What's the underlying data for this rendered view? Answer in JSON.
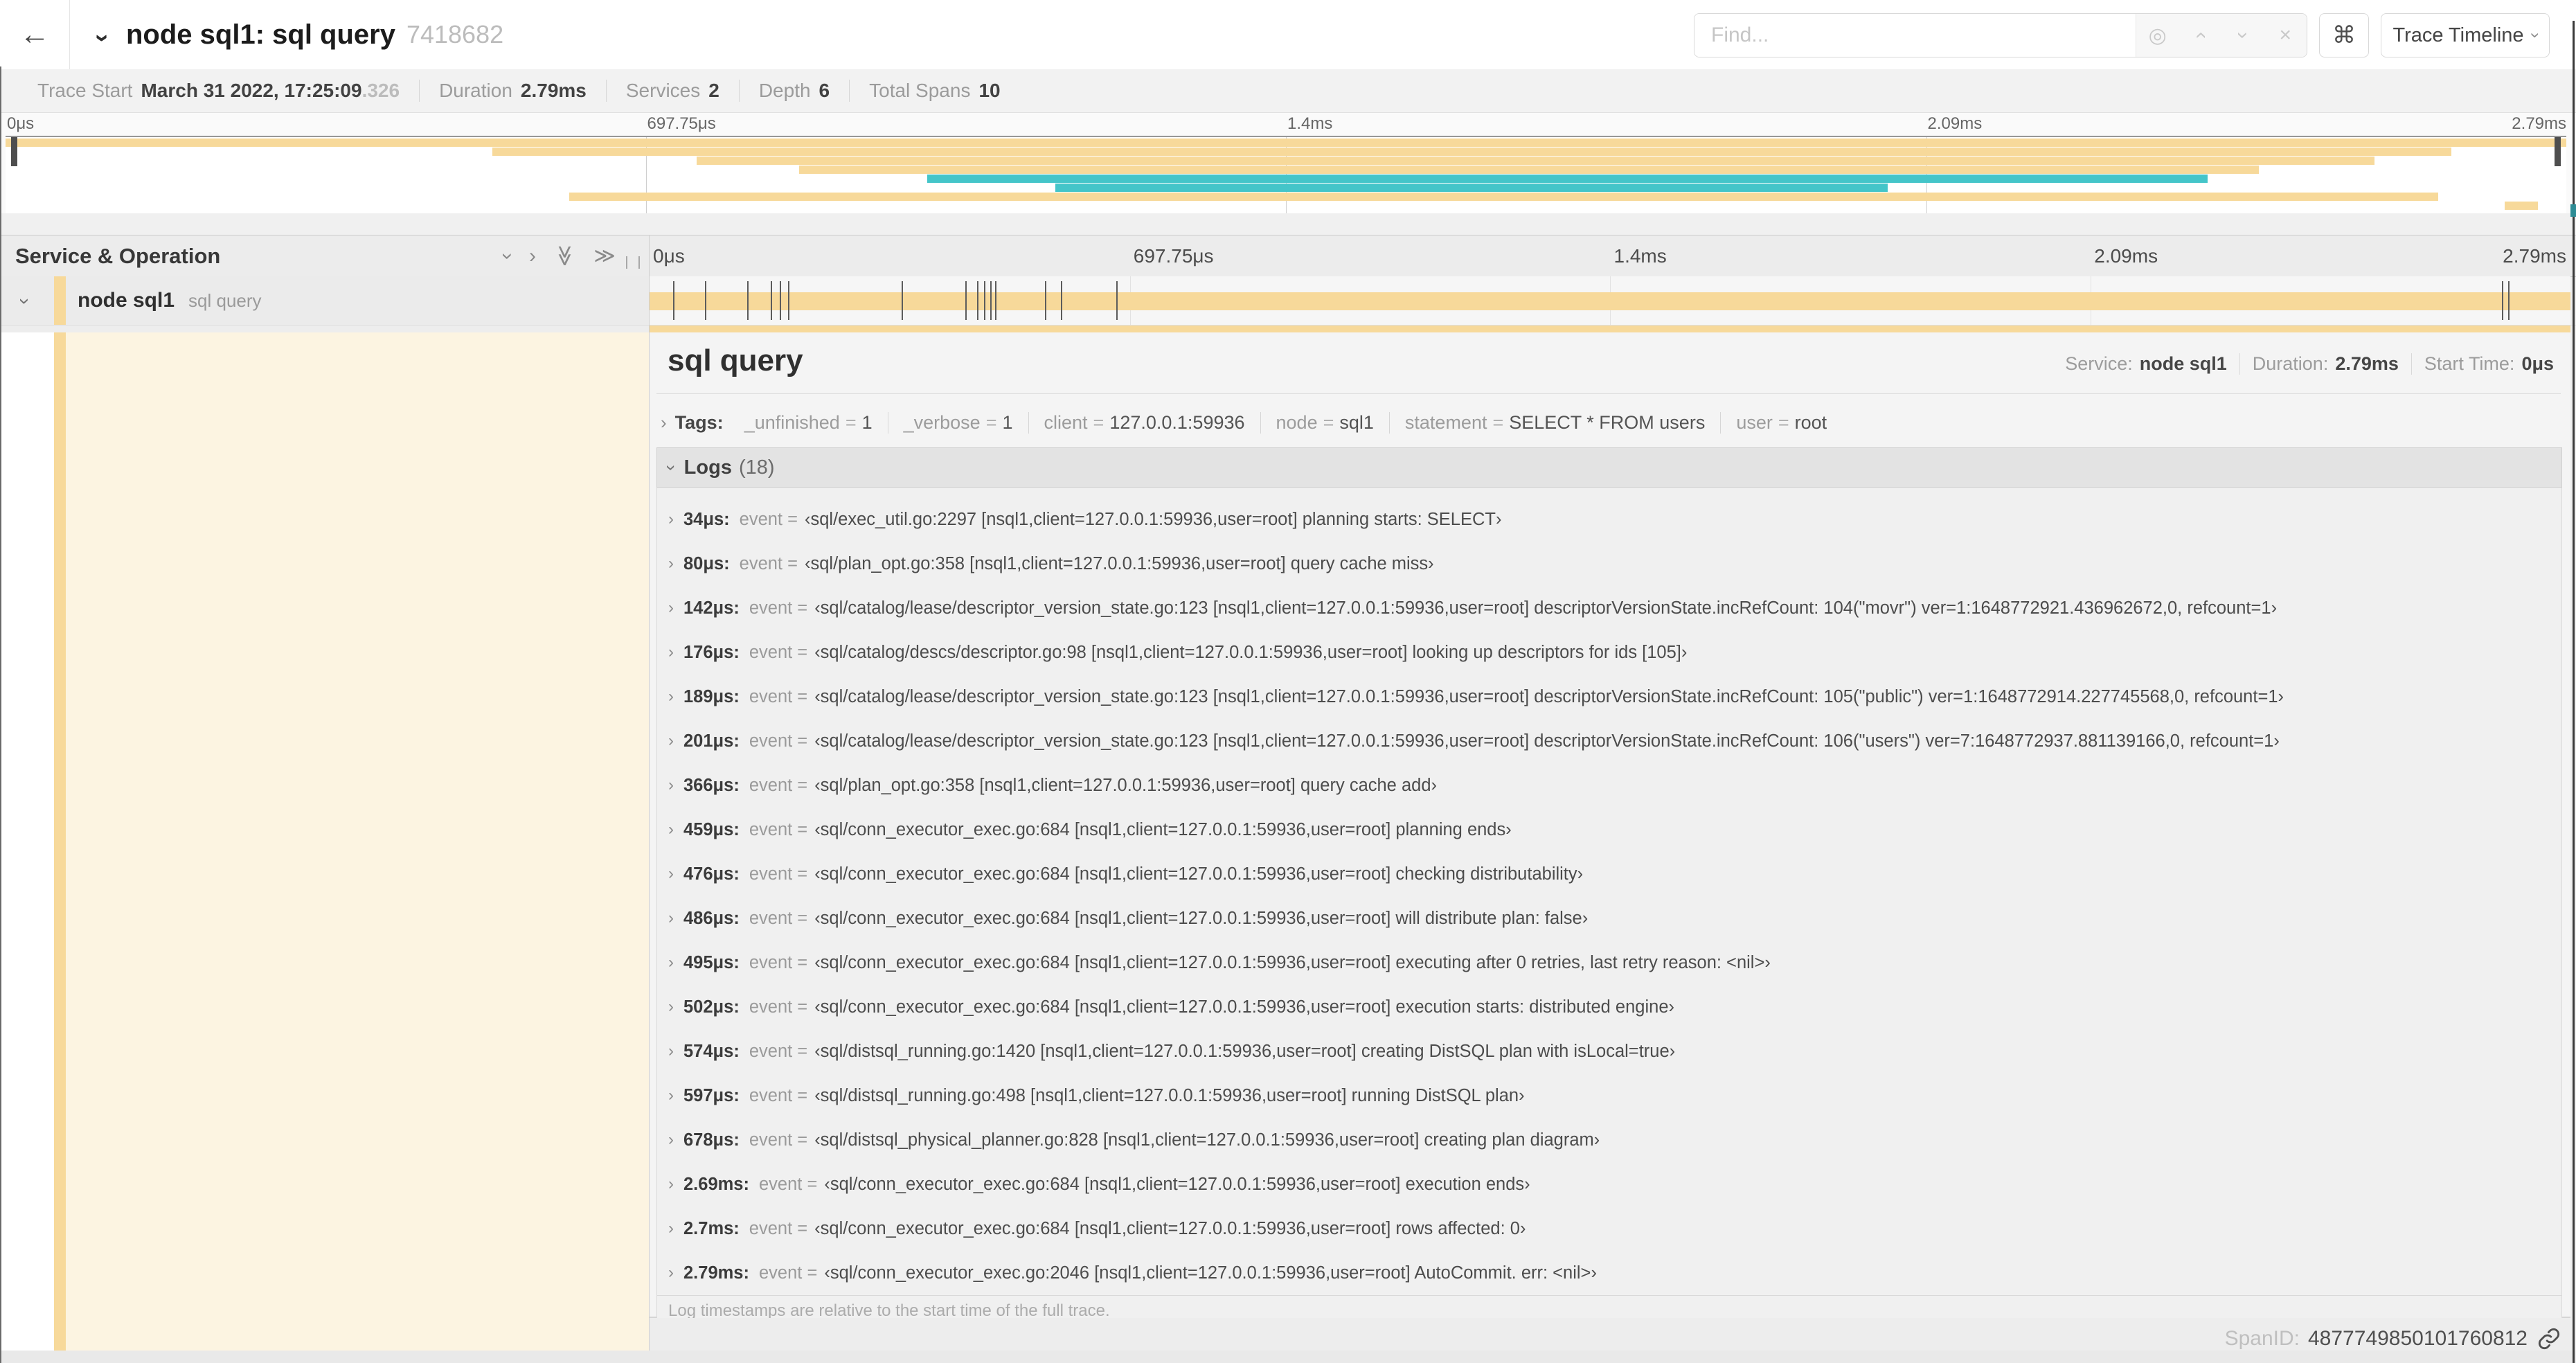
{
  "icons": {
    "back": "←",
    "chevron": "›",
    "double_chevron": "≫",
    "target": "◎",
    "close": "×",
    "cmd": "⌘",
    "grip": "",
    "link": "link"
  },
  "colors": {
    "span_tan": "#F7D99A",
    "span_teal": "#44C5C9",
    "cream": "#FCF4E1"
  },
  "header": {
    "title": "node sql1: sql query",
    "trace_id": "7418682",
    "find_placeholder": "Find...",
    "view_button": "Trace Timeline"
  },
  "meta": {
    "items": [
      {
        "label": "Trace Start",
        "value": "March 31 2022, 17:25:09",
        "extra": ".326"
      },
      {
        "label": "Duration",
        "value": "2.79ms",
        "extra": ""
      },
      {
        "label": "Services",
        "value": "2",
        "extra": ""
      },
      {
        "label": "Depth",
        "value": "6",
        "extra": ""
      },
      {
        "label": "Total Spans",
        "value": "10",
        "extra": ""
      }
    ]
  },
  "minimap": {
    "ticks": [
      {
        "label": "0μs",
        "l": "2px"
      },
      {
        "label": "697.75μs",
        "l": "calc(25% + 2px)"
      },
      {
        "label": "1.4ms",
        "l": "calc(50% + 2px)"
      },
      {
        "label": "2.09ms",
        "l": "calc(75% + 2px)"
      },
      {
        "label": "2.79ms",
        "l": "100%"
      }
    ],
    "spans": [
      {
        "c": "#F7D99A",
        "l": "0%",
        "w": "100%",
        "t": "2px"
      },
      {
        "c": "#F7D99A",
        "l": "19%",
        "w": "76.5%",
        "t": "15px"
      },
      {
        "c": "#F7D99A",
        "l": "27%",
        "w": "65.5%",
        "t": "28px"
      },
      {
        "c": "#F7D99A",
        "l": "31%",
        "w": "57%",
        "t": "41px"
      },
      {
        "c": "#44C5C9",
        "l": "36%",
        "w": "50%",
        "t": "54px"
      },
      {
        "c": "#44C5C9",
        "l": "41%",
        "w": "32.5%",
        "t": "67px"
      },
      {
        "c": "#F7D99A",
        "l": "22%",
        "w": "73%",
        "t": "80px"
      },
      {
        "c": "#F7D99A",
        "l": "97.6%",
        "w": "1.3%",
        "t": "93px"
      }
    ]
  },
  "timeline": {
    "column_title": "Service & Operation",
    "ticks": [
      {
        "label": "0μs",
        "l": "6px"
      },
      {
        "label": "697.75μs",
        "l": "calc(25% + 6px)"
      },
      {
        "label": "1.4ms",
        "l": "calc(50% + 6px)"
      },
      {
        "label": "2.09ms",
        "l": "calc(75% + 6px)"
      },
      {
        "label": "2.79ms",
        "l": "100%"
      }
    ]
  },
  "span_row": {
    "service": "node sql1",
    "operation": "sql query",
    "events": [
      {
        "l": "1.22%"
      },
      {
        "l": "2.87%"
      },
      {
        "l": "5.09%"
      },
      {
        "l": "6.31%"
      },
      {
        "l": "6.77%"
      },
      {
        "l": "7.2%"
      },
      {
        "l": "13.12%"
      },
      {
        "l": "16.45%"
      },
      {
        "l": "17.06%"
      },
      {
        "l": "17.42%"
      },
      {
        "l": "17.74%"
      },
      {
        "l": "18.0%"
      },
      {
        "l": "20.57%"
      },
      {
        "l": "21.4%"
      },
      {
        "l": "24.3%"
      },
      {
        "l": "96.42%"
      },
      {
        "l": "96.77%"
      }
    ]
  },
  "detail": {
    "title": "sql query",
    "overview": [
      {
        "label": "Service:",
        "value": "node sql1"
      },
      {
        "label": "Duration:",
        "value": "2.79ms"
      },
      {
        "label": "Start Time:",
        "value": "0μs"
      }
    ],
    "tags_label": "Tags:",
    "tags": [
      {
        "k": "_unfinished",
        "eq": "=",
        "v": "1"
      },
      {
        "k": "_verbose",
        "eq": "=",
        "v": "1"
      },
      {
        "k": "client",
        "eq": "=",
        "v": "127.0.0.1:59936"
      },
      {
        "k": "node",
        "eq": "=",
        "v": "sql1"
      },
      {
        "k": "statement",
        "eq": "=",
        "v": "SELECT * FROM users"
      },
      {
        "k": "user",
        "eq": "=",
        "v": "root"
      }
    ],
    "logs_label": "Logs",
    "logs_count": "(18)",
    "logs": [
      {
        "t": "34μs:",
        "k": "event =",
        "v": "‹sql/exec_util.go:2297 [nsql1,client=127.0.0.1:59936,user=root] planning starts: SELECT›"
      },
      {
        "t": "80μs:",
        "k": "event =",
        "v": "‹sql/plan_opt.go:358 [nsql1,client=127.0.0.1:59936,user=root] query cache miss›"
      },
      {
        "t": "142μs:",
        "k": "event =",
        "v": "‹sql/catalog/lease/descriptor_version_state.go:123 [nsql1,client=127.0.0.1:59936,user=root] descriptorVersionState.incRefCount: 104(\"movr\") ver=1:1648772921.436962672,0, refcount=1›"
      },
      {
        "t": "176μs:",
        "k": "event =",
        "v": "‹sql/catalog/descs/descriptor.go:98 [nsql1,client=127.0.0.1:59936,user=root] looking up descriptors for ids [105]›"
      },
      {
        "t": "189μs:",
        "k": "event =",
        "v": "‹sql/catalog/lease/descriptor_version_state.go:123 [nsql1,client=127.0.0.1:59936,user=root] descriptorVersionState.incRefCount: 105(\"public\") ver=1:1648772914.227745568,0, refcount=1›"
      },
      {
        "t": "201μs:",
        "k": "event =",
        "v": "‹sql/catalog/lease/descriptor_version_state.go:123 [nsql1,client=127.0.0.1:59936,user=root] descriptorVersionState.incRefCount: 106(\"users\") ver=7:1648772937.881139166,0, refcount=1›"
      },
      {
        "t": "366μs:",
        "k": "event =",
        "v": "‹sql/plan_opt.go:358 [nsql1,client=127.0.0.1:59936,user=root] query cache add›"
      },
      {
        "t": "459μs:",
        "k": "event =",
        "v": "‹sql/conn_executor_exec.go:684 [nsql1,client=127.0.0.1:59936,user=root] planning ends›"
      },
      {
        "t": "476μs:",
        "k": "event =",
        "v": "‹sql/conn_executor_exec.go:684 [nsql1,client=127.0.0.1:59936,user=root] checking distributability›"
      },
      {
        "t": "486μs:",
        "k": "event =",
        "v": "‹sql/conn_executor_exec.go:684 [nsql1,client=127.0.0.1:59936,user=root] will distribute plan: false›"
      },
      {
        "t": "495μs:",
        "k": "event =",
        "v": "‹sql/conn_executor_exec.go:684 [nsql1,client=127.0.0.1:59936,user=root] executing after 0 retries, last retry reason: <nil>›"
      },
      {
        "t": "502μs:",
        "k": "event =",
        "v": "‹sql/conn_executor_exec.go:684 [nsql1,client=127.0.0.1:59936,user=root] execution starts: distributed engine›"
      },
      {
        "t": "574μs:",
        "k": "event =",
        "v": "‹sql/distsql_running.go:1420 [nsql1,client=127.0.0.1:59936,user=root] creating DistSQL plan with isLocal=true›"
      },
      {
        "t": "597μs:",
        "k": "event =",
        "v": "‹sql/distsql_running.go:498 [nsql1,client=127.0.0.1:59936,user=root] running DistSQL plan›"
      },
      {
        "t": "678μs:",
        "k": "event =",
        "v": "‹sql/distsql_physical_planner.go:828 [nsql1,client=127.0.0.1:59936,user=root] creating plan diagram›"
      },
      {
        "t": "2.69ms:",
        "k": "event =",
        "v": "‹sql/conn_executor_exec.go:684 [nsql1,client=127.0.0.1:59936,user=root] execution ends›"
      },
      {
        "t": "2.7ms:",
        "k": "event =",
        "v": "‹sql/conn_executor_exec.go:684 [nsql1,client=127.0.0.1:59936,user=root] rows affected: 0›"
      },
      {
        "t": "2.79ms:",
        "k": "event =",
        "v": "‹sql/conn_executor_exec.go:2046 [nsql1,client=127.0.0.1:59936,user=root] AutoCommit. err: <nil>›"
      }
    ],
    "footer": "Log timestamps are relative to the start time of the full trace.",
    "spanid_label": "SpanID:",
    "spanid": "4877749850101760812"
  }
}
